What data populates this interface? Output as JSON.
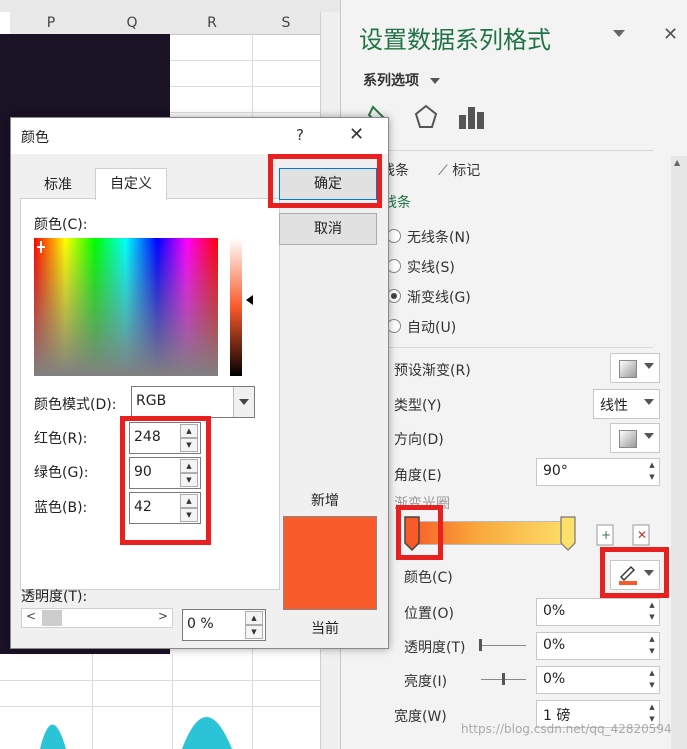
{
  "spreadsheet": {
    "columns": [
      "P",
      "Q",
      "R",
      "S"
    ]
  },
  "pane": {
    "title": "设置数据系列格式",
    "series_options": "系列选项",
    "tabs": {
      "line": "线条",
      "marker": "标记"
    },
    "section_line": "线条",
    "radios": [
      "无线条(N)",
      "实线(S)",
      "渐变线(G)",
      "自动(U)"
    ],
    "selected_radio": "渐变线(G)",
    "preset_gradient": "预设渐变(R)",
    "type_label": "类型(Y)",
    "type_value": "线性",
    "direction_label": "方向(D)",
    "angle_label": "角度(E)",
    "angle_value": "90°",
    "stops_label": "渐变光圈",
    "color_label": "颜色(C)",
    "position_label": "位置(O)",
    "position_value": "0%",
    "transparency_label": "透明度(T)",
    "transparency_value": "0%",
    "brightness_label": "亮度(I)",
    "brightness_value": "0%",
    "width_label": "宽度(W)",
    "width_value": "1 磅",
    "stop_color": "#f85a2a"
  },
  "dialog": {
    "title": "颜色",
    "help": "?",
    "close": "✕",
    "tabs": [
      "标准",
      "自定义"
    ],
    "active_tab": "自定义",
    "colors_label": "颜色(C):",
    "color_model_label": "颜色模式(D):",
    "color_model_value": "RGB",
    "red_label": "红色(R):",
    "red_value": "248",
    "green_label": "绿色(G):",
    "green_value": "90",
    "blue_label": "蓝色(B):",
    "blue_value": "42",
    "transparency_label": "透明度(T):",
    "transparency_value": "0 %",
    "ok_button": "确定",
    "cancel_button": "取消",
    "new_label": "新增",
    "current_label": "当前",
    "new_color": "#f85a2a",
    "current_color": "#f85a2a"
  },
  "watermark": "https://blog.csdn.net/qq_42820594"
}
